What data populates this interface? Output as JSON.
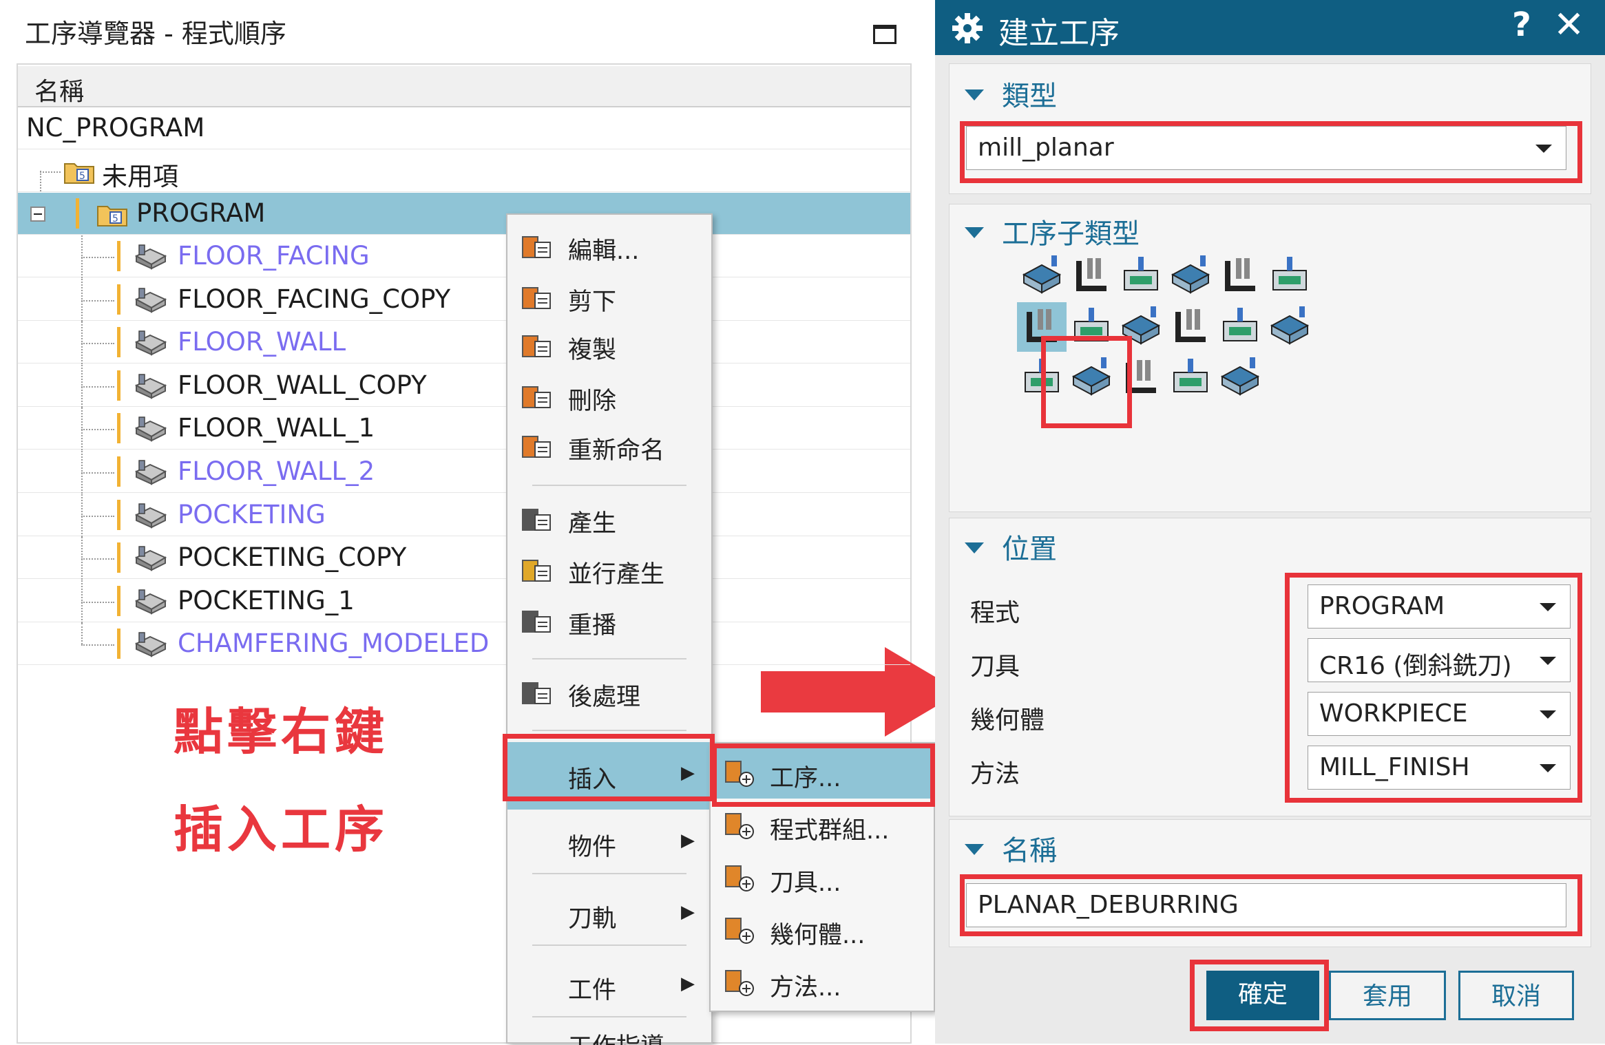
{
  "navigator": {
    "title": "工序導覽器 - 程式順序",
    "column_header": "名稱",
    "root": "NC_PROGRAM",
    "unused": "未用項",
    "program": "PROGRAM",
    "operations": [
      {
        "name": "FLOOR_FACING",
        "color": "#7a6cf0"
      },
      {
        "name": "FLOOR_FACING_COPY",
        "color": "#1c1c1c"
      },
      {
        "name": "FLOOR_WALL",
        "color": "#7a6cf0"
      },
      {
        "name": "FLOOR_WALL_COPY",
        "color": "#1c1c1c"
      },
      {
        "name": "FLOOR_WALL_1",
        "color": "#1c1c1c"
      },
      {
        "name": "FLOOR_WALL_2",
        "color": "#7a6cf0"
      },
      {
        "name": "POCKETING",
        "color": "#7a6cf0"
      },
      {
        "name": "POCKETING_COPY",
        "color": "#1c1c1c"
      },
      {
        "name": "POCKETING_1",
        "color": "#1c1c1c"
      },
      {
        "name": "CHAMFERING_MODELED",
        "color": "#7a6cf0"
      }
    ]
  },
  "annotation": {
    "line1": "點擊右鍵",
    "line2": "插入工序",
    "color": "#e9373e"
  },
  "context_menu": {
    "items": [
      {
        "label": "編輯...",
        "icon": "edit-icon"
      },
      {
        "label": "剪下",
        "icon": "cut-icon"
      },
      {
        "label": "複製",
        "icon": "copy-icon"
      },
      {
        "label": "刪除",
        "icon": "delete-icon"
      },
      {
        "label": "重新命名",
        "icon": "rename-icon"
      },
      {
        "label": "產生",
        "icon": "generate-icon"
      },
      {
        "label": "並行產生",
        "icon": "parallel-generate-icon"
      },
      {
        "label": "重播",
        "icon": "replay-icon"
      },
      {
        "label": "後處理",
        "icon": "postprocess-icon"
      }
    ],
    "insert": "插入",
    "object": "物件",
    "toolpath": "刀軌",
    "workpiece": "工件",
    "last_partial": "工作指導"
  },
  "submenu": {
    "items": [
      {
        "label": "工序...",
        "icon": "operation-icon"
      },
      {
        "label": "程式群組...",
        "icon": "program-group-icon"
      },
      {
        "label": "刀具...",
        "icon": "tool-icon"
      },
      {
        "label": "幾何體...",
        "icon": "geometry-icon"
      },
      {
        "label": "方法...",
        "icon": "method-icon"
      }
    ]
  },
  "dialog": {
    "title": "建立工序",
    "help": "?",
    "close": "✕",
    "type_section": "類型",
    "type_value": "mill_planar",
    "subtype_section": "工序子類型",
    "location_section": "位置",
    "program_label": "程式",
    "program_value": "PROGRAM",
    "tool_label": "刀具",
    "tool_value": "CR16 (倒斜銑刀)",
    "geometry_label": "幾何體",
    "geometry_value": "WORKPIECE",
    "method_label": "方法",
    "method_value": "MILL_FINISH",
    "name_section": "名稱",
    "name_value": "PLANAR_DEBURRING",
    "ok": "確定",
    "apply": "套用",
    "cancel": "取消",
    "title_bar_color": "#0f5e82",
    "accent_color": "#1c6e96",
    "highlight_color": "#e8333a"
  }
}
